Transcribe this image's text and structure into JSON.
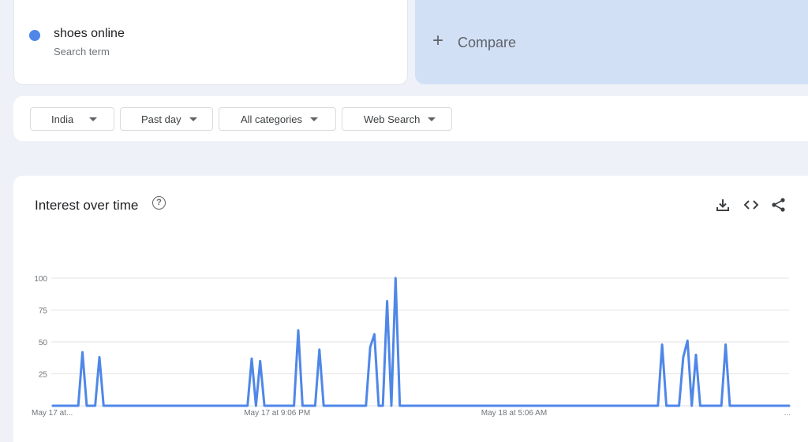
{
  "search_term": {
    "name": "shoes online",
    "subtitle": "Search term",
    "color": "#4f87e8"
  },
  "compare": {
    "label": "Compare",
    "icon": "plus-icon"
  },
  "filters": [
    {
      "label": "India"
    },
    {
      "label": "Past day"
    },
    {
      "label": "All categories"
    },
    {
      "label": "Web Search"
    }
  ],
  "chart": {
    "title": "Interest over time",
    "icons": [
      "help-icon",
      "download-icon",
      "embed-code-icon",
      "share-icon"
    ]
  },
  "chart_data": {
    "type": "line",
    "title": "Interest over time",
    "xlabel": "",
    "ylabel": "",
    "ylim": [
      0,
      100
    ],
    "yticks": [
      25,
      50,
      75,
      100
    ],
    "grid": true,
    "x_tick_labels": [
      "May 17 at...",
      "May 17 at 9:06 PM",
      "May 18 at 5:06 AM",
      "..."
    ],
    "x_tick_positions": [
      0,
      53,
      109,
      174
    ],
    "series": [
      {
        "color": "#4f87e8",
        "x": [
          0,
          6,
          7,
          8,
          10,
          11,
          12,
          13,
          14,
          46,
          47,
          48,
          49,
          50,
          51,
          57,
          58,
          59,
          62,
          63,
          64,
          74,
          75,
          76,
          77,
          78,
          79,
          80,
          81,
          82,
          83,
          143,
          144,
          145,
          148,
          149,
          150,
          151,
          152,
          153,
          154,
          158,
          159,
          160,
          174
        ],
        "values": [
          0,
          0,
          42,
          0,
          0,
          38,
          0,
          0,
          0,
          0,
          37,
          0,
          35,
          0,
          0,
          0,
          59,
          0,
          0,
          44,
          0,
          0,
          46,
          56,
          0,
          0,
          82,
          0,
          100,
          0,
          0,
          0,
          48,
          0,
          0,
          38,
          51,
          0,
          40,
          0,
          0,
          0,
          48,
          0,
          0
        ]
      }
    ]
  }
}
